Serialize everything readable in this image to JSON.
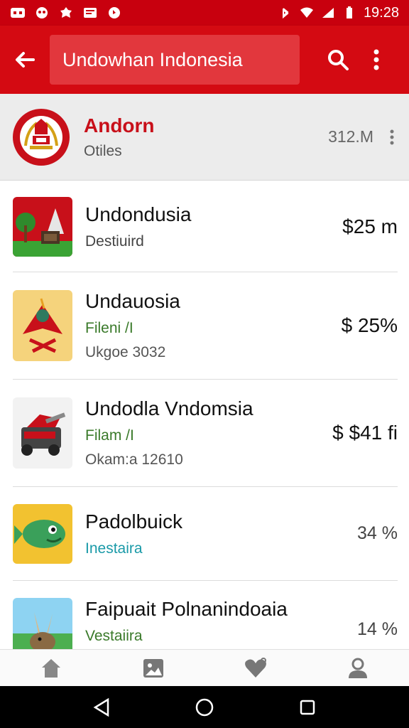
{
  "status_bar": {
    "time": "19:28",
    "left_icons": [
      "notification-icon",
      "app-icon",
      "settings-icon",
      "message-icon",
      "media-icon"
    ],
    "right_icons": [
      "bluetooth-icon",
      "wifi-icon",
      "signal-icon",
      "battery-icon"
    ]
  },
  "app_bar": {
    "search_text": "Undowhan Indonesia"
  },
  "featured": {
    "title": "Andorn",
    "subtitle": "Otiles",
    "size": "312.M"
  },
  "items": [
    {
      "title": "Undondusia",
      "sub1": "Destiuird",
      "sub2": "",
      "price": "$25 m",
      "thumb": "forest-landscape"
    },
    {
      "title": "Undauosia",
      "sub1": "Fileni /I",
      "sub2": "Ukgoe 3032",
      "price": "$ 25%",
      "thumb": "bird-game"
    },
    {
      "title": "Undodla Vndomsia",
      "sub1": "Filam /I",
      "sub2": "Okam:a 12610",
      "price": "$ $41 fi",
      "thumb": "robot-vehicle"
    },
    {
      "title": "Padolbuick",
      "sub1": "Inestaira",
      "sub2": "",
      "price": "34 %",
      "thumb": "green-fish"
    },
    {
      "title": "Faipuait Polnanindoaia",
      "sub1": "Vestaiira",
      "sub2": "",
      "price": "14 %",
      "thumb": "rabbit-scene"
    }
  ],
  "bottom_nav": [
    "home-icon",
    "gallery-icon",
    "favorite-icon",
    "profile-icon"
  ],
  "colors": {
    "primary": "#d40a12",
    "status": "#c8000e",
    "accent_text": "#c8101a",
    "teal": "#1a9aa8"
  }
}
